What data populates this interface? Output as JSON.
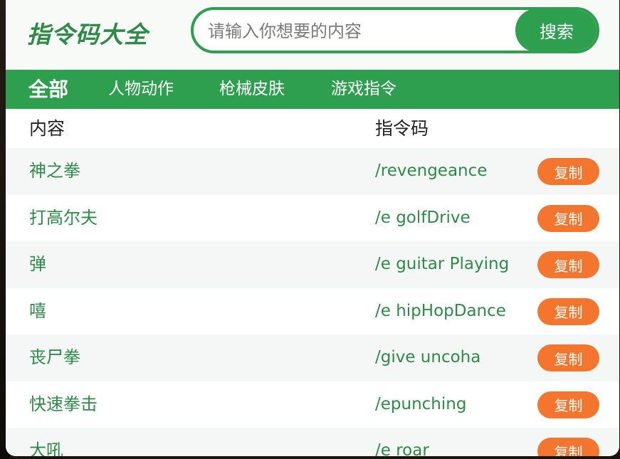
{
  "brand": {
    "logo_text": "指令码大全",
    "accent_color": "#2e9e4f",
    "button_color": "#f4762e"
  },
  "search": {
    "placeholder": "请输入你想要的内容",
    "value": "",
    "button_label": "搜索"
  },
  "tabs": [
    {
      "label": "全部",
      "active": true
    },
    {
      "label": "人物动作",
      "active": false
    },
    {
      "label": "枪械皮肤",
      "active": false
    },
    {
      "label": "游戏指令",
      "active": false
    }
  ],
  "table": {
    "columns": {
      "content": "内容",
      "code": "指令码"
    },
    "rows": [
      {
        "name": "神之拳",
        "code": "/revengeance",
        "action": "复制"
      },
      {
        "name": "打高尔夫",
        "code": "/e golfDrive",
        "action": "复制"
      },
      {
        "name": "弹",
        "code": "/e guitar Playing",
        "action": "复制"
      },
      {
        "name": "嘻",
        "code": "/e hipHopDance",
        "action": "复制"
      },
      {
        "name": "丧尸拳",
        "code": "/give uncoha",
        "action": "复制"
      },
      {
        "name": "快速拳击",
        "code": "/epunching",
        "action": "复制"
      },
      {
        "name": "大吼",
        "code": "/e roar",
        "action": "复制"
      }
    ]
  }
}
